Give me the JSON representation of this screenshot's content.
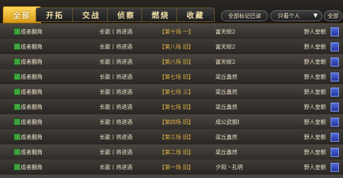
{
  "tabs": [
    "全部",
    "开拓",
    "交战",
    "侦察",
    "燃烧",
    "收藏"
  ],
  "active_tab": 0,
  "controls": {
    "mark_all_read": "全部标记已读",
    "filter": "只看个人",
    "all": "全部"
  },
  "rows": [
    {
      "name": "成者翻角",
      "where": "长歌丨将进酒",
      "loc": "【第十场 一】",
      "who": "富天晾2",
      "ally": "野人皇朝"
    },
    {
      "name": "成者翻角",
      "where": "长歌丨将进酒",
      "loc": "【第八场 旧】",
      "who": "富天晾2",
      "ally": "野人皇朝"
    },
    {
      "name": "成者翻角",
      "where": "长歌丨将进酒",
      "loc": "【第八场 旧】",
      "who": "富天晾2",
      "ally": "野人皇朝"
    },
    {
      "name": "成者翻角",
      "where": "长歌丨将进酒",
      "loc": "【第七场 旧】",
      "who": "梁丘鑫然",
      "ally": "野人皇朝"
    },
    {
      "name": "成者翻角",
      "where": "长歌丨将进酒",
      "loc": "【第七场 三】",
      "who": "梁丘鑫然",
      "ally": "野人皇朝"
    },
    {
      "name": "成者翻角",
      "where": "长歌丨将进酒",
      "loc": "【第七场 旧】",
      "who": "梁丘鑫然",
      "ally": "野人皇朝"
    },
    {
      "name": "成者翻角",
      "where": "长歌丨将进酒",
      "loc": "【第四场 旧】",
      "who": "成公武钢I",
      "ally": "野人皇朝"
    },
    {
      "name": "成者翻角",
      "where": "长歌丨将进酒",
      "loc": "【第三场 旧】",
      "who": "梁丘鑫然",
      "ally": "野人皇朝"
    },
    {
      "name": "成者翻角",
      "where": "长歌丨将进酒",
      "loc": "【第二场 旧】",
      "who": "梁丘鑫然",
      "ally": "野人皇朝"
    },
    {
      "name": "成者翻角",
      "where": "长歌丨将进酒",
      "loc": "【第一场 旧】",
      "who": "夕阳丶孔明",
      "ally": "野人皇朝"
    }
  ]
}
